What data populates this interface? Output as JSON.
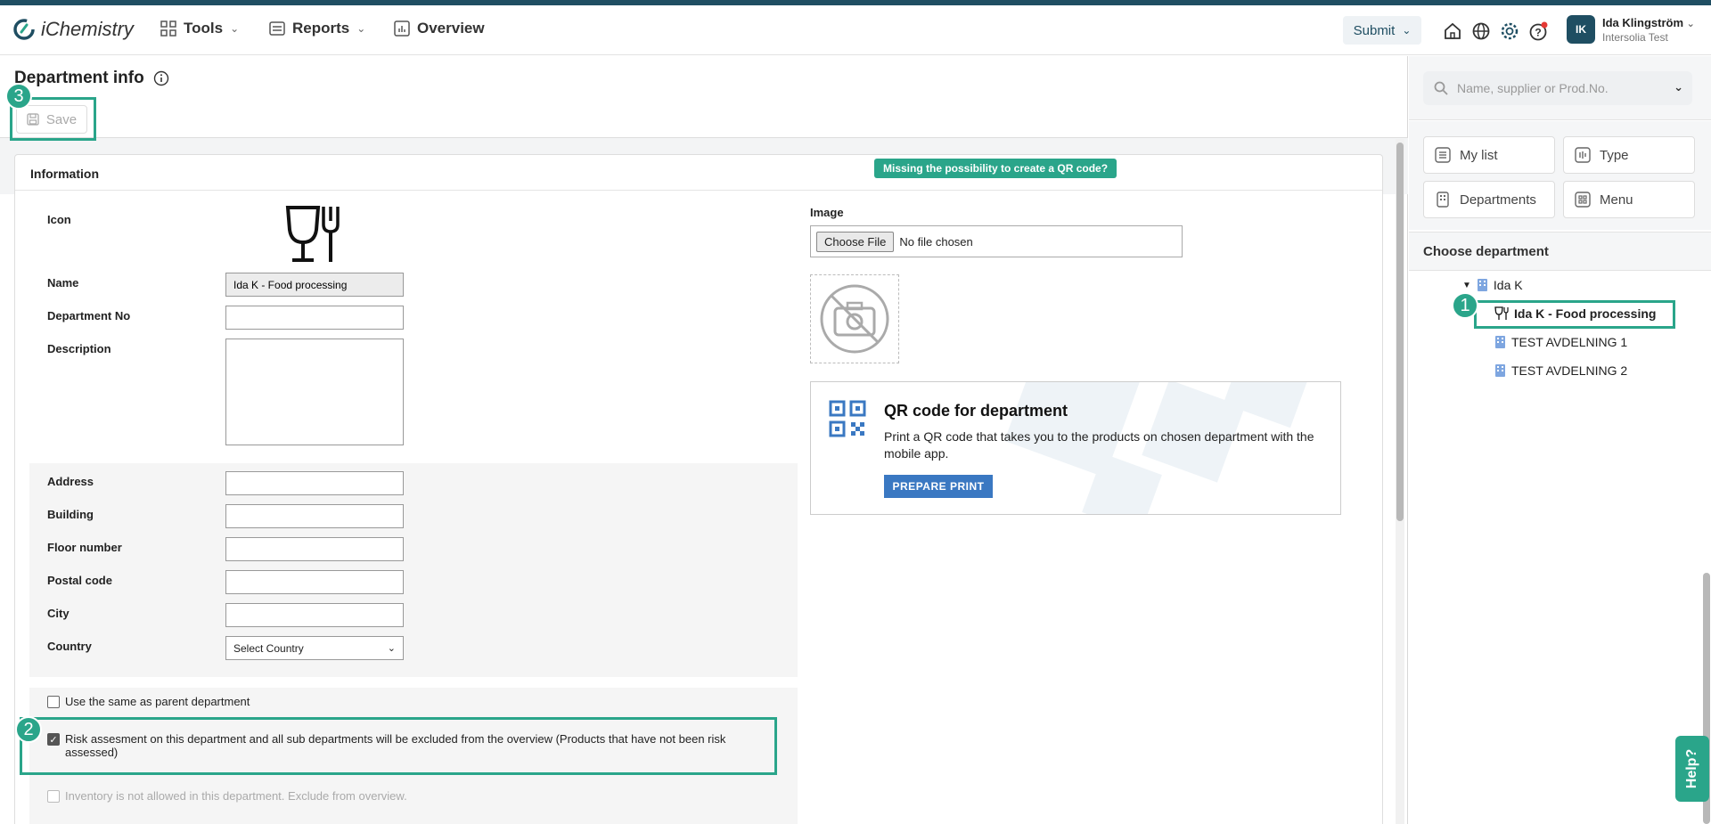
{
  "app": {
    "name": "iChemistry"
  },
  "nav": {
    "tools": "Tools",
    "reports": "Reports",
    "overview": "Overview",
    "submit": "Submit"
  },
  "user": {
    "initials": "IK",
    "name": "Ida Klingström",
    "org": "Intersolia Test"
  },
  "page": {
    "title": "Department info",
    "save": "Save"
  },
  "info": {
    "header": "Information",
    "qr_missing": "Missing the possibility to create a QR code?",
    "icon_label": "Icon",
    "name_label": "Name",
    "name_value": "Ida K - Food processing",
    "deptno_label": "Department No",
    "desc_label": "Description",
    "address_label": "Address",
    "building_label": "Building",
    "floor_label": "Floor number",
    "postal_label": "Postal code",
    "city_label": "City",
    "country_label": "Country",
    "country_value": "Select Country",
    "same_parent": "Use the same as parent department",
    "risk_excluded": "Risk assesment on this department and all sub departments will be excluded from the overview (Products that have not been risk assessed)",
    "inventory_not_allowed": "Inventory is not allowed in this department. Exclude from overview.",
    "image_label": "Image",
    "choose_file": "Choose File",
    "no_file": "No file chosen"
  },
  "qr": {
    "title": "QR code for department",
    "desc": "Print a QR code that takes you to the products on chosen department with the mobile app.",
    "button": "PREPARE PRINT"
  },
  "sidebar": {
    "search_placeholder": "Name, supplier or Prod.No.",
    "tiles": {
      "mylist": "My list",
      "type": "Type",
      "departments": "Departments",
      "menu": "Menu"
    },
    "choose_dept": "Choose department",
    "tree": {
      "root": "Ida K",
      "selected": "Ida K - Food processing",
      "t1": "TEST AVDELNING 1",
      "t2": "TEST AVDELNING 2"
    }
  },
  "badges": {
    "one": "1",
    "two": "2",
    "three": "3"
  },
  "help": "Help?",
  "colors": {
    "accent": "#2aa58a",
    "brand": "#1f4e62",
    "button": "#3a78c2"
  }
}
